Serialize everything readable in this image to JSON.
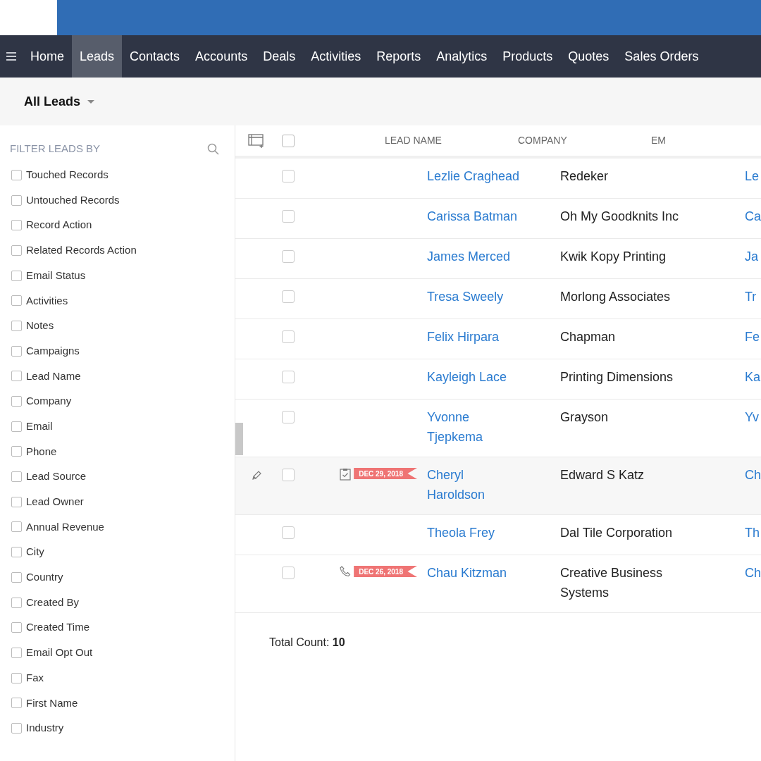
{
  "nav": {
    "tabs": [
      {
        "label": "Home",
        "selected": false
      },
      {
        "label": "Leads",
        "selected": true
      },
      {
        "label": "Contacts",
        "selected": false
      },
      {
        "label": "Accounts",
        "selected": false
      },
      {
        "label": "Deals",
        "selected": false
      },
      {
        "label": "Activities",
        "selected": false
      },
      {
        "label": "Reports",
        "selected": false
      },
      {
        "label": "Analytics",
        "selected": false
      },
      {
        "label": "Products",
        "selected": false
      },
      {
        "label": "Quotes",
        "selected": false
      },
      {
        "label": "Sales Orders",
        "selected": false
      }
    ]
  },
  "view_selector": {
    "label": "All Leads"
  },
  "sidebar": {
    "title": "FILTER LEADS BY",
    "filters": [
      {
        "label": "Touched Records",
        "checked": false
      },
      {
        "label": "Untouched Records",
        "checked": false
      },
      {
        "label": "Record Action",
        "checked": false
      },
      {
        "label": "Related Records Action",
        "checked": false
      },
      {
        "label": "Email Status",
        "checked": false
      },
      {
        "label": "Activities",
        "checked": false
      },
      {
        "label": "Notes",
        "checked": false
      },
      {
        "label": "Campaigns",
        "checked": false
      },
      {
        "label": "Lead Name",
        "checked": false
      },
      {
        "label": "Company",
        "checked": false
      },
      {
        "label": "Email",
        "checked": false
      },
      {
        "label": "Phone",
        "checked": false
      },
      {
        "label": "Lead Source",
        "checked": false
      },
      {
        "label": "Lead Owner",
        "checked": false
      },
      {
        "label": "Annual Revenue",
        "checked": false
      },
      {
        "label": "City",
        "checked": false
      },
      {
        "label": "Country",
        "checked": false
      },
      {
        "label": "Created By",
        "checked": false
      },
      {
        "label": "Created Time",
        "checked": false
      },
      {
        "label": "Email Opt Out",
        "checked": false
      },
      {
        "label": "Fax",
        "checked": false
      },
      {
        "label": "First Name",
        "checked": false
      },
      {
        "label": "Industry",
        "checked": false
      }
    ]
  },
  "table": {
    "select_all_checked": false,
    "columns": [
      "LEAD NAME",
      "COMPANY",
      "EM"
    ],
    "rows": [
      {
        "name": "Lezlie Craghead",
        "company": "Redeker",
        "email": "Le",
        "checked": false,
        "hovered": false
      },
      {
        "name": "Carissa Batman",
        "company": "Oh My Goodknits Inc",
        "email": "Ca",
        "checked": false,
        "hovered": false
      },
      {
        "name": "James Merced",
        "company": "Kwik Kopy Printing",
        "email": "Ja",
        "checked": false,
        "hovered": false
      },
      {
        "name": "Tresa Sweely",
        "company": "Morlong Associates",
        "email": "Tr",
        "checked": false,
        "hovered": false
      },
      {
        "name": "Felix Hirpara",
        "company": "Chapman",
        "email": "Fe",
        "checked": false,
        "hovered": false
      },
      {
        "name": "Kayleigh Lace",
        "company": "Printing Dimensions",
        "email": "Ka",
        "checked": false,
        "hovered": false
      },
      {
        "name": "Yvonne Tjepkema",
        "company": "Grayson",
        "email": "Yv",
        "checked": false,
        "hovered": false
      },
      {
        "name": "Cheryl Haroldson",
        "company": "Edward S Katz",
        "email": "Ch",
        "checked": false,
        "hovered": true,
        "activity": {
          "kind": "task",
          "date": "DEC 29, 2018"
        }
      },
      {
        "name": "Theola Frey",
        "company": "Dal Tile Corporation",
        "email": "Th",
        "checked": false,
        "hovered": false
      },
      {
        "name": "Chau Kitzman",
        "company": "Creative Business Systems",
        "email": "Ch",
        "checked": false,
        "hovered": false,
        "activity": {
          "kind": "call",
          "date": "DEC 26, 2018"
        }
      }
    ],
    "total_label": "Total Count:",
    "total_value": "10"
  }
}
